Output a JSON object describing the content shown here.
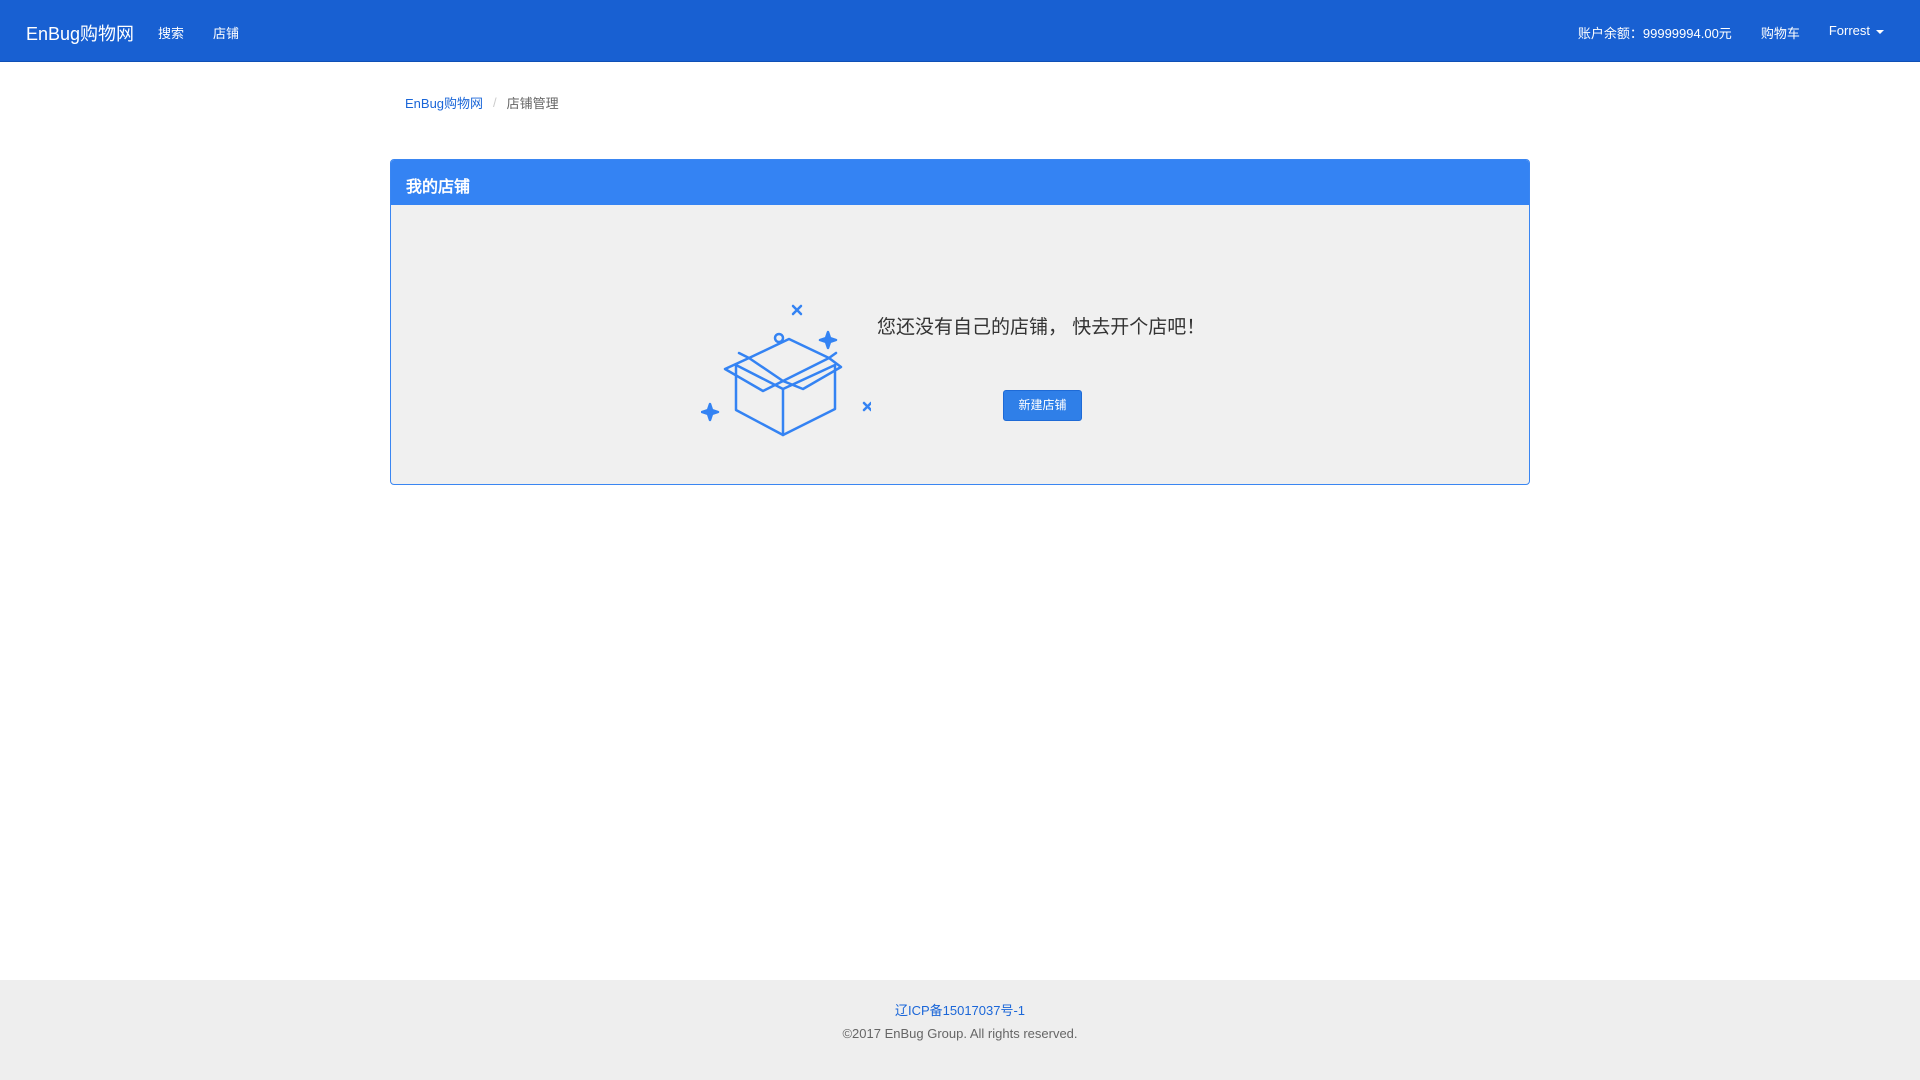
{
  "navbar": {
    "brand": "EnBug购物网",
    "left_links": [
      "搜索",
      "店铺"
    ],
    "balance": "账户余额：99999994.00元",
    "cart": "购物车",
    "user": "Forrest"
  },
  "breadcrumb": {
    "home": "EnBug购物网",
    "separator": "/",
    "current": "店铺管理"
  },
  "panel": {
    "title": "我的店铺",
    "empty_message": "您还没有自己的店铺， 快去开个店吧！",
    "create_button": "新建店铺",
    "illustration_icon": "empty-box-icon"
  },
  "footer": {
    "icp": "辽ICP备15017037号-1",
    "copyright": "©2017 EnBug Group. All rights reserved."
  },
  "colors": {
    "navbar": "#1860d2",
    "panel_heading": "#3483f3",
    "accent": "#2f7fe8",
    "panel_body": "#f0f0f0",
    "footer": "#eeeeee"
  }
}
